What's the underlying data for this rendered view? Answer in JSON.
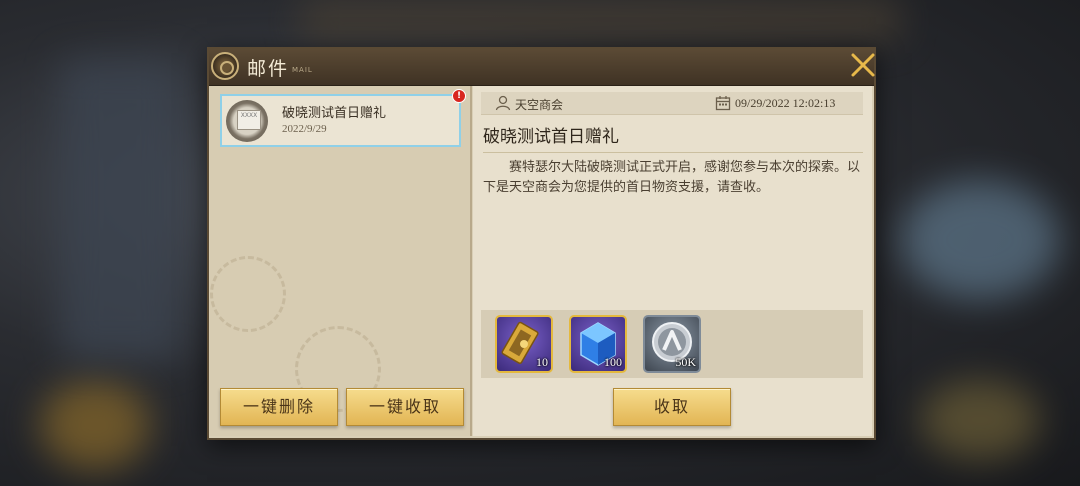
{
  "window": {
    "title": "邮件",
    "title_sub": "MAIL"
  },
  "mail_list": [
    {
      "title": "破晓测试首日赠礼",
      "date": "2022/9/29",
      "icon_text": "XXXX",
      "unread_badge": "!"
    }
  ],
  "left_actions": {
    "delete_all_label": "一键删除",
    "claim_all_label": "一键收取"
  },
  "detail": {
    "sender": "天空商会",
    "datetime": "09/29/2022 12:02:13",
    "heading": "破晓测试首日赠礼",
    "body": "赛特瑟尔大陆破晓测试正式开启，感谢您参与本次的探索。以下是天空商会为您提供的首日物资支援，请查收。",
    "attachments": [
      {
        "icon": "golden-ticket-icon",
        "count": "10"
      },
      {
        "icon": "blue-crystal-icon",
        "count": "100"
      },
      {
        "icon": "silver-coin-icon",
        "count": "50K"
      }
    ],
    "claim_label": "收取"
  },
  "colors": {
    "selected_border": "#8fd0e8",
    "button_gold": "#e2b554",
    "close_icon": "#e7b94a"
  }
}
